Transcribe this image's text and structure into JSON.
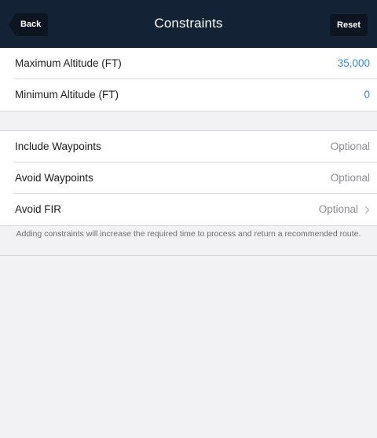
{
  "navbar": {
    "title": "Constraints",
    "back_label": "Back",
    "reset_label": "Reset"
  },
  "altitude_group": [
    {
      "label": "Maximum Altitude (FT)",
      "value": "35,000"
    },
    {
      "label": "Minimum Altitude (FT)",
      "value": "0"
    }
  ],
  "route_group": [
    {
      "label": "Include Waypoints",
      "value": "Optional"
    },
    {
      "label": "Avoid Waypoints",
      "value": "Optional"
    },
    {
      "label": "Avoid FIR",
      "value": "Optional"
    }
  ],
  "footer_note": "Adding constraints will increase the required time to process and return a recommended route.",
  "icons": {
    "back": "back-arrow-icon",
    "row_disclosure": "chevron-right-icon"
  },
  "colors": {
    "navbar_bg": "#142235",
    "value_blue": "#3b86d6",
    "value_gray": "#8e8e93",
    "page_bg": "#f2f2f4"
  }
}
